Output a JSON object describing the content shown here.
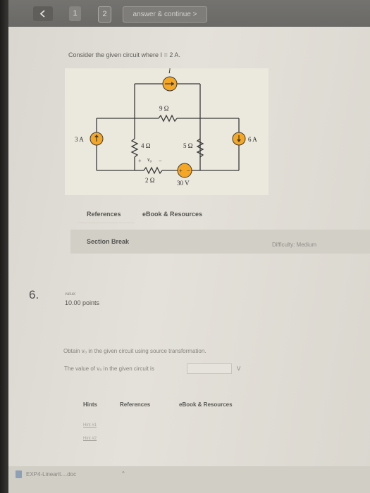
{
  "topbar": {
    "back_icon": "chevron-left-icon",
    "question_1": "1",
    "question_2": "2",
    "answer_continue": "answer & continue >"
  },
  "problem": {
    "prompt": "Consider the given circuit where I = 2 A.",
    "circuit": {
      "current_label": "I",
      "r_9": "9 Ω",
      "r_4": "4 Ω",
      "r_5": "5 Ω",
      "r_2": "2 Ω",
      "src_3a": "3 A",
      "src_6a": "6 A",
      "src_30v": "30 V",
      "vo_label": "v₀",
      "plus": "+",
      "minus": "−"
    },
    "tabs": [
      "References",
      "eBook & Resources"
    ],
    "section_break": "Section Break",
    "difficulty": "Difficulty: Medium"
  },
  "question6": {
    "number": "6.",
    "value_label": "value:",
    "points": "10.00 points",
    "text": "Obtain v₀ in the given circuit using source transformation.",
    "answer_prefix": "The value of v₀ in the given circuit is",
    "answer_value": "",
    "unit": "V",
    "tabs": [
      "Hints",
      "References",
      "eBook & Resources"
    ],
    "hints": [
      "Hint #1",
      "Hint #2"
    ]
  },
  "downloads": {
    "item": "EXP4-Linearit....doc",
    "chevron": "^"
  },
  "colors": {
    "topbar": "#6e6d6a",
    "page": "#e0ddd6",
    "circuit_bg": "#ebe8dd",
    "source_fill": "#f5a623",
    "wire": "#3a3a3a"
  }
}
